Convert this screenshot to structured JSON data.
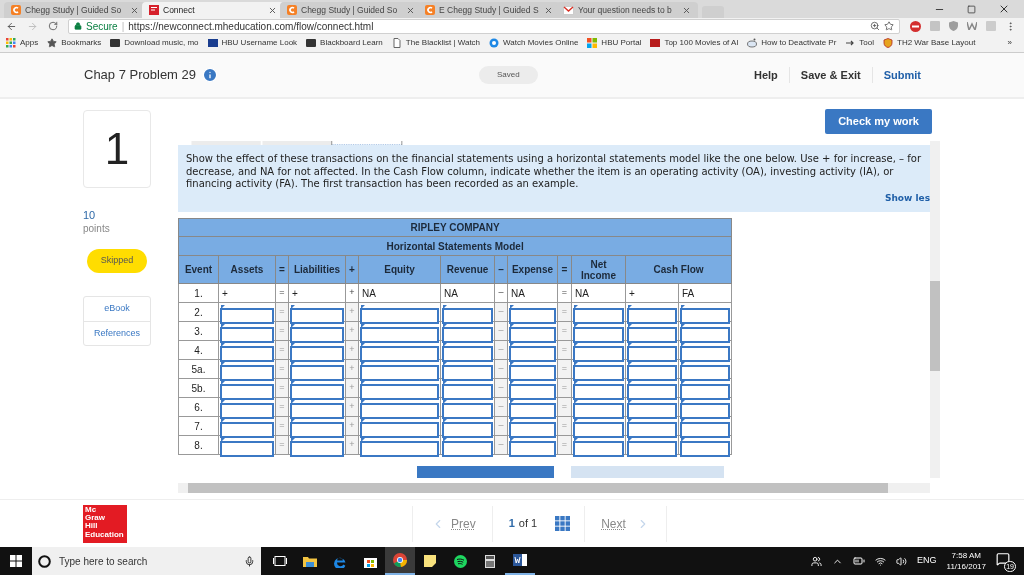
{
  "browser": {
    "tabs": [
      {
        "title": "Chegg Study | Guided So",
        "kind": "chegg",
        "selected": false
      },
      {
        "title": "Connect",
        "kind": "mcgraw",
        "selected": true
      },
      {
        "title": "Chegg Study | Guided So",
        "kind": "chegg",
        "selected": false
      },
      {
        "title": "E Chegg Study | Guided S",
        "kind": "chegg",
        "selected": false
      },
      {
        "title": "Your question needs to b",
        "kind": "gmail",
        "selected": false
      }
    ],
    "secure_label": "Secure",
    "separator": "|",
    "url": "https://newconnect.mheducation.com/flow/connect.html",
    "bookmarks": [
      {
        "label": "Apps",
        "kind": "apps"
      },
      {
        "label": "Bookmarks",
        "kind": "star"
      },
      {
        "label": "Download music, mo",
        "kind": "dark"
      },
      {
        "label": "HBU Username Look",
        "kind": "blue"
      },
      {
        "label": "Blackboard Learn",
        "kind": "dark"
      },
      {
        "label": "The Blacklist | Watch",
        "kind": "page"
      },
      {
        "label": "Watch Movies Online",
        "kind": "circle"
      },
      {
        "label": "HBU Portal",
        "kind": "tiles"
      },
      {
        "label": "Top 100 Movies of Al",
        "kind": "red"
      },
      {
        "label": "How to Deactivate Pr",
        "kind": "alien"
      },
      {
        "label": "Tool",
        "kind": "arrow"
      },
      {
        "label": "TH2 War Base Layout",
        "kind": "shield"
      }
    ],
    "bookmarks_more": "»"
  },
  "header": {
    "title": "Chap 7 Problem 29",
    "saved": "Saved",
    "nav": [
      {
        "label": "Help",
        "kind": "plain"
      },
      {
        "label": "Save & Exit",
        "kind": "plain"
      },
      {
        "label": "Submit",
        "kind": "primary"
      }
    ]
  },
  "sidebar": {
    "question_number": "1",
    "points": "10",
    "points_label": "points",
    "status": "Skipped",
    "links": [
      "eBook",
      "References"
    ]
  },
  "check_button": "Check my work",
  "instructions": {
    "text": "Show the effect of these transactions on the financial statements using a horizontal statements model like the one below. Use + for increase, – for decrease, and NA for not affected. In the Cash Flow column, indicate whether the item is an operating activity (OA), investing activity (IA), or financing activity (FA). The first transaction has been recorded as an example.",
    "toggle": "Show les"
  },
  "table": {
    "title": "RIPLEY COMPANY",
    "subtitle": "Horizontal Statements Model",
    "columns": [
      {
        "label": "Event",
        "kind": "field"
      },
      {
        "label": "Assets",
        "kind": "field"
      },
      {
        "label": "=",
        "kind": "operator"
      },
      {
        "label": "Liabilities",
        "kind": "field"
      },
      {
        "label": "+",
        "kind": "operator"
      },
      {
        "label": "Equity",
        "kind": "field"
      },
      {
        "label": "Revenue",
        "kind": "field"
      },
      {
        "label": "–",
        "kind": "operator"
      },
      {
        "label": "Expense",
        "kind": "field"
      },
      {
        "label": "=",
        "kind": "operator"
      },
      {
        "label": "Net Income",
        "kind": "field"
      },
      {
        "label": "Cash Flow",
        "kind": "pair"
      }
    ],
    "rows": [
      {
        "event": "1.",
        "editable": false,
        "operators": [
          "=",
          "+",
          "–",
          "="
        ],
        "values": [
          "+",
          "+",
          "NA",
          "NA",
          "NA",
          "NA",
          "+",
          "FA"
        ]
      },
      {
        "event": "2.",
        "editable": true,
        "operators": [
          "=",
          "+",
          "–",
          "="
        ]
      },
      {
        "event": "3.",
        "editable": true,
        "operators": [
          "=",
          "+",
          "–",
          "="
        ]
      },
      {
        "event": "4.",
        "editable": true,
        "operators": [
          "=",
          "+",
          "–",
          "="
        ]
      },
      {
        "event": "5a.",
        "editable": true,
        "operators": [
          "=",
          "+",
          "–",
          "="
        ]
      },
      {
        "event": "5b.",
        "editable": true,
        "operators": [
          "=",
          "+",
          "–",
          "="
        ]
      },
      {
        "event": "6.",
        "editable": true,
        "operators": [
          "=",
          "+",
          "–",
          "="
        ]
      },
      {
        "event": "7.",
        "editable": true,
        "operators": [
          "=",
          "+",
          "–",
          "="
        ]
      },
      {
        "event": "8.",
        "editable": true,
        "operators": [
          "=",
          "+",
          "–",
          "="
        ]
      }
    ]
  },
  "footer": {
    "logo_lines": [
      "Mc",
      "Graw",
      "Hill",
      "Education"
    ],
    "prev": "Prev",
    "page": "1",
    "page_of": "of 1",
    "next": "Next"
  },
  "taskbar": {
    "search_placeholder": "Type here to search",
    "language": "ENG",
    "time": "7:58 AM",
    "date": "11/16/2017",
    "notifications": "19"
  }
}
